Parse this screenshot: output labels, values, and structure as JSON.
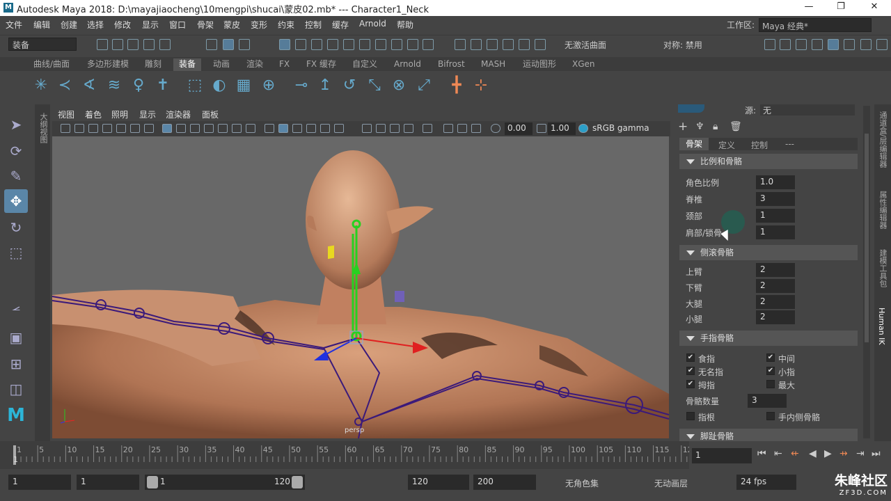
{
  "title_bar": {
    "text": "Autodesk Maya 2018: D:\\mayajiaocheng\\10mengpi\\shucai\\蒙皮02.mb*   ---   Character1_Neck",
    "logo": "M"
  },
  "menu": [
    "文件",
    "编辑",
    "创建",
    "选择",
    "修改",
    "显示",
    "窗口",
    "骨架",
    "蒙皮",
    "变形",
    "约束",
    "控制",
    "缓存",
    "Arnold",
    "帮助"
  ],
  "workspace": {
    "label": "工作区:",
    "value": "Maya 经典*"
  },
  "status_line": {
    "mode": "装备",
    "live_surface": "无激活曲面",
    "symmetry": "对称: 禁用"
  },
  "shelf_tabs": [
    "曲线/曲面",
    "多边形建模",
    "雕刻",
    "装备",
    "动画",
    "渲染",
    "FX",
    "FX 缓存",
    "自定义",
    "Arnold",
    "Bifrost",
    "MASH",
    "运动图形",
    "XGen"
  ],
  "shelf_active": "装备",
  "viewport_menu": [
    "视图",
    "着色",
    "照明",
    "显示",
    "渲染器",
    "面板"
  ],
  "viewport_toolbar": {
    "exposure": "0.00",
    "gamma": "1.00",
    "color_space": "sRGB gamma"
  },
  "viewport_label": "persp",
  "side_strip_label": "大纲视图",
  "right_panel": {
    "source_label": "源:",
    "source_value": "无",
    "tabs": [
      "骨架",
      "定义",
      "控制",
      "---"
    ],
    "sections": {
      "scale": {
        "title": "比例和骨骼",
        "rows": [
          {
            "label": "角色比例",
            "value": "1.0"
          },
          {
            "label": "脊椎",
            "value": "3"
          },
          {
            "label": "颈部",
            "value": "1"
          },
          {
            "label": "肩部/锁骨",
            "value": "1"
          }
        ]
      },
      "roll": {
        "title": "侧滚骨骼",
        "rows": [
          {
            "label": "上臂",
            "value": "2"
          },
          {
            "label": "下臂",
            "value": "2"
          },
          {
            "label": "大腿",
            "value": "2"
          },
          {
            "label": "小腿",
            "value": "2"
          }
        ]
      },
      "fingers": {
        "title": "手指骨骼",
        "checks": [
          {
            "label": "食指",
            "checked": true
          },
          {
            "label": "中间",
            "checked": true
          },
          {
            "label": "无名指",
            "checked": true
          },
          {
            "label": "小指",
            "checked": true
          },
          {
            "label": "拇指",
            "checked": true
          },
          {
            "label": "最大",
            "checked": false
          }
        ],
        "count_label": "骨骼数量",
        "count_value": "3",
        "extra": [
          {
            "label": "指根",
            "checked": false
          },
          {
            "label": "手内侧骨骼",
            "checked": false
          }
        ]
      },
      "feet": {
        "title": "脚趾骨骼"
      }
    }
  },
  "right_tabs": [
    "通道盒/层编辑器",
    "属性编辑器",
    "建模工具包",
    "Human IK"
  ],
  "timeline": {
    "ticks": [
      "1",
      "5",
      "10",
      "15",
      "20",
      "25",
      "30",
      "35",
      "40",
      "45",
      "50",
      "55",
      "60",
      "65",
      "70",
      "75",
      "80",
      "85",
      "90",
      "95",
      "100",
      "105",
      "110",
      "115",
      "12"
    ],
    "current_frame": "1"
  },
  "range": {
    "start": "1",
    "anim_start": "1",
    "slider_start": "1",
    "slider_end": "120",
    "end": "120",
    "anim_end": "200",
    "character_set": "无角色集",
    "anim_layer": "无动画层",
    "fps": "24 fps"
  },
  "watermark": {
    "brand": "朱峰社区",
    "url": "ZF3D.COM"
  }
}
